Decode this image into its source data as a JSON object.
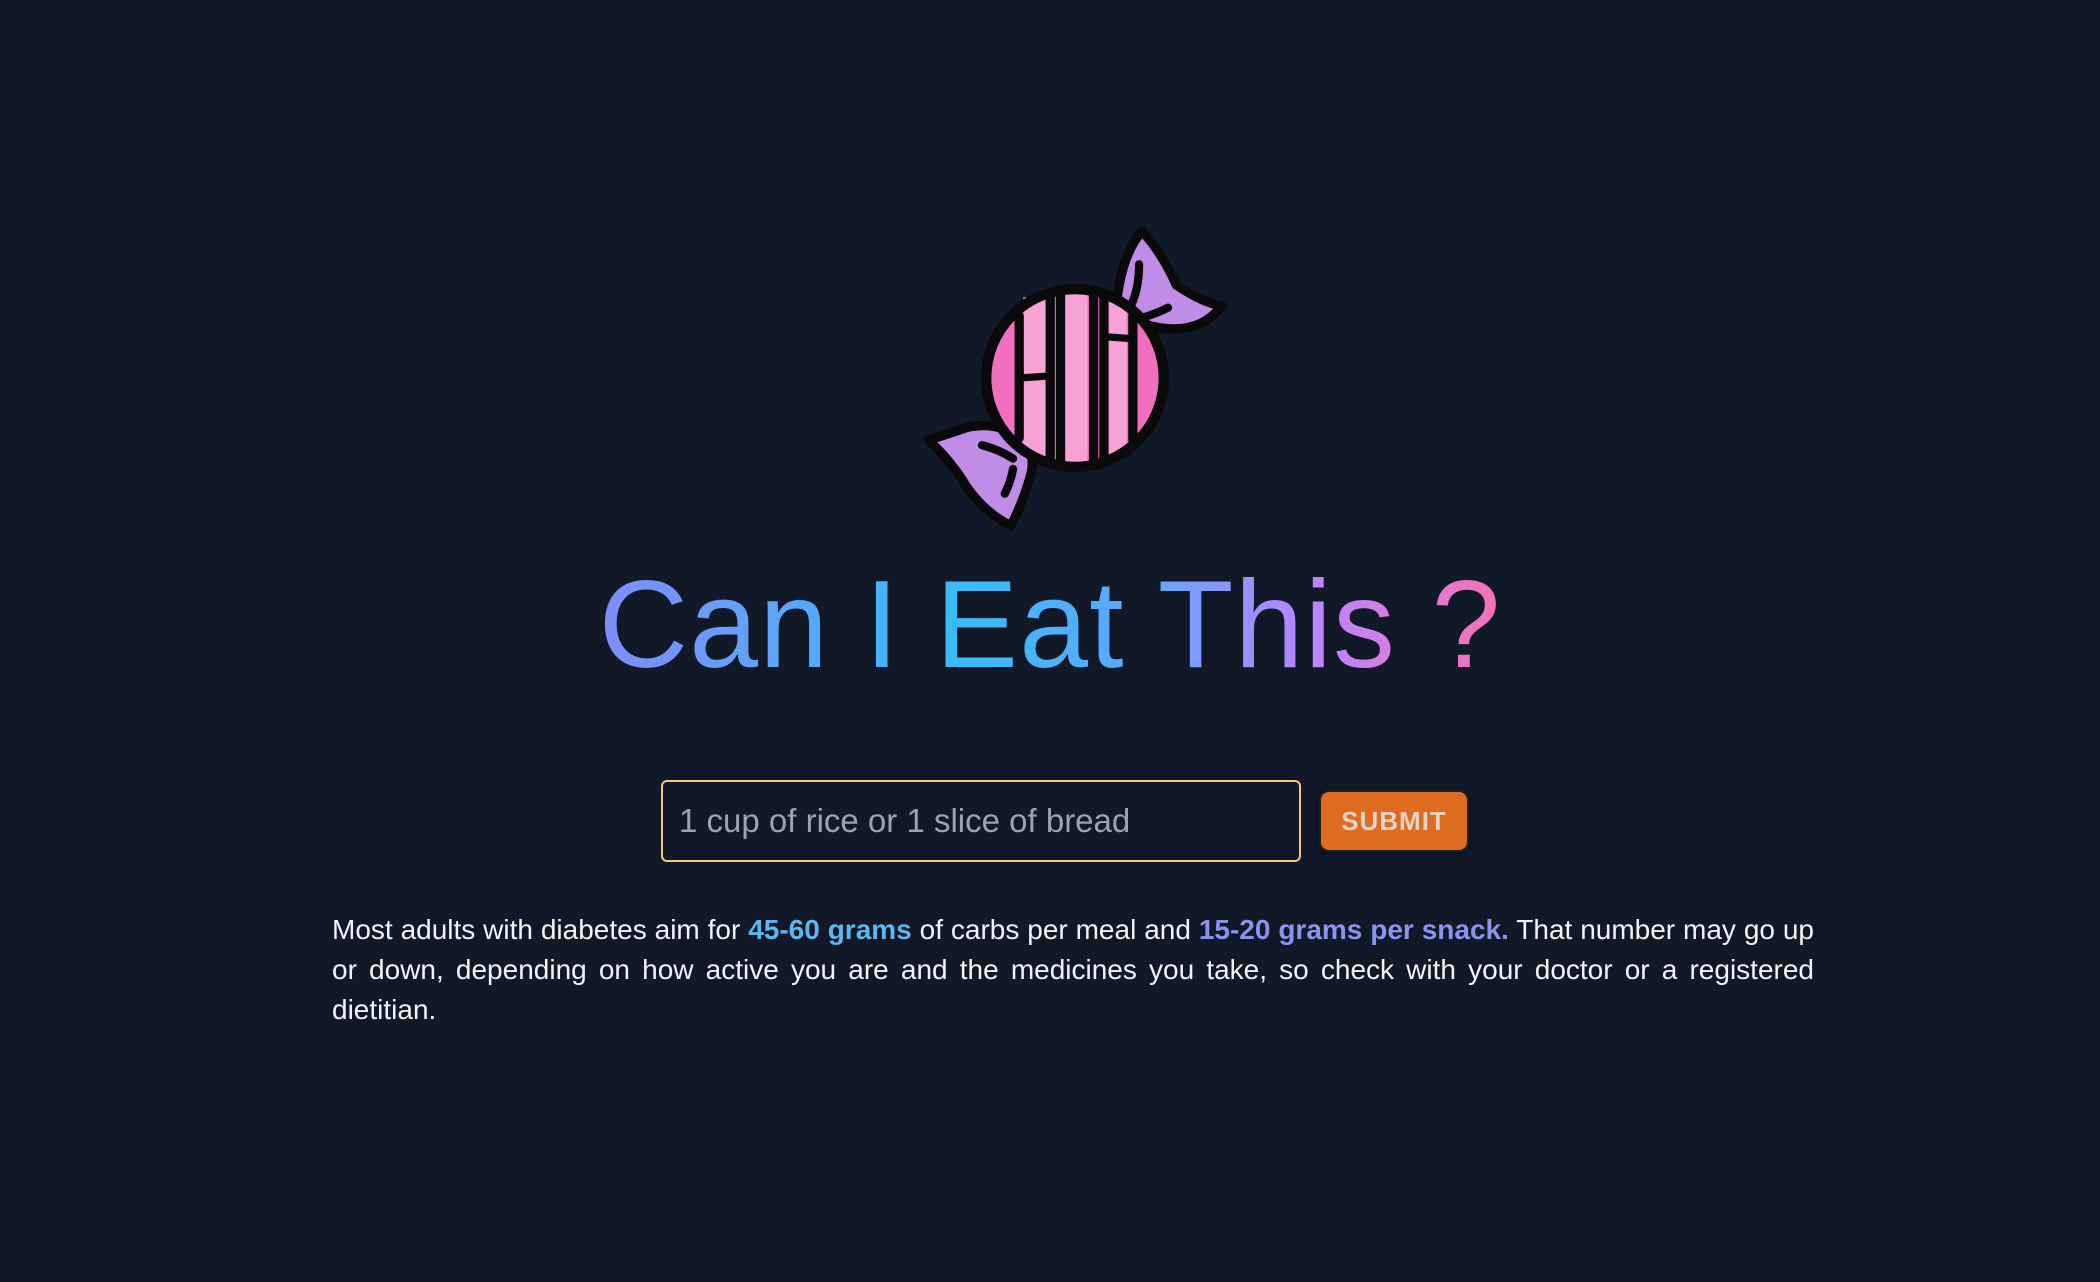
{
  "title": {
    "text": "Can I Eat This ?"
  },
  "logo": {
    "icon": "candy-icon",
    "colors": {
      "body": "#f06fbf",
      "stripe": "#f7a2d4",
      "wrapper": "#c08ce8",
      "outline": "#0a0a0a"
    }
  },
  "search": {
    "placeholder": "1 cup of rice or 1 slice of bread",
    "value": ""
  },
  "submit": {
    "label": "SUBMIT"
  },
  "info": {
    "part1": "Most adults with diabetes aim for ",
    "highlight_meal": "45-60 grams",
    "part2": " of carbs per meal and ",
    "highlight_snack": "15-20 grams per snack.",
    "part3": " That number may go up or down, depending on how active you are and the medicines you take, so check with your doctor or a registered dietitian."
  },
  "colors": {
    "background": "#111827",
    "input_border": "#f6c67a",
    "submit_bg": "#dd6b20",
    "highlight_meal": "#5eb6f0",
    "highlight_snack": "#8b93f0"
  }
}
